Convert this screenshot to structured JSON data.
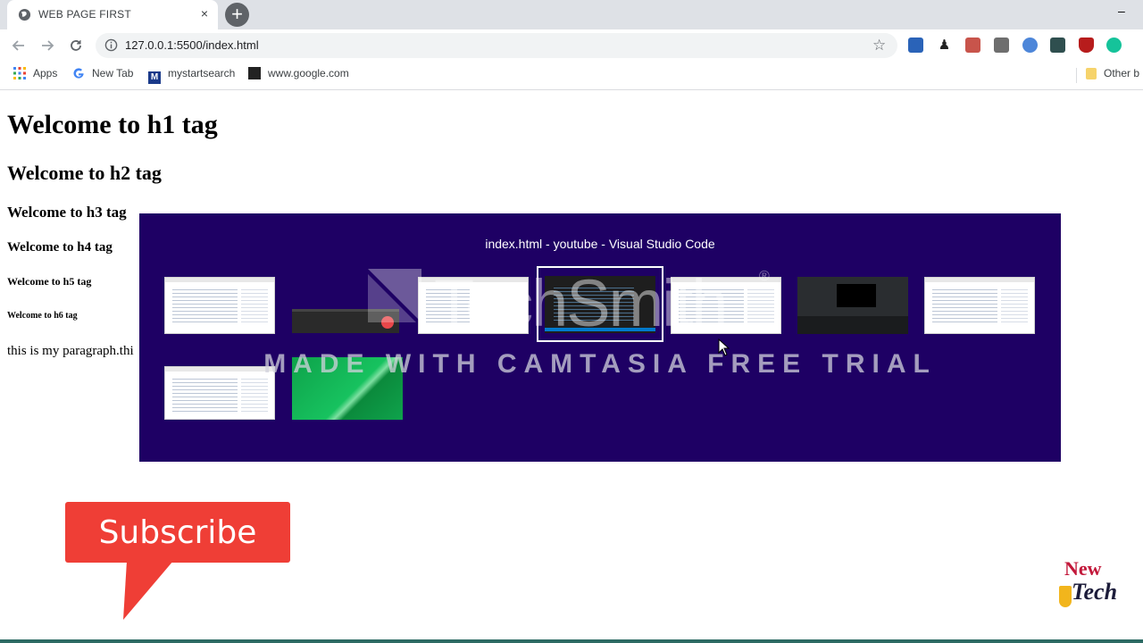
{
  "browser": {
    "tab_title": "WEB PAGE FIRST",
    "tab_close": "×",
    "new_tab": "+",
    "url": "127.0.0.1:5500/index.html",
    "window_minimize": "–"
  },
  "bookmarks": [
    {
      "label": "Apps",
      "icon": "apps-grid-icon"
    },
    {
      "label": "New Tab",
      "icon": "google-g-icon"
    },
    {
      "label": "mystartsearch",
      "icon": "mystartsearch-icon"
    },
    {
      "label": "www.google.com",
      "icon": "bookmark-page-icon"
    },
    {
      "label": "Other b",
      "icon": "folder-icon"
    }
  ],
  "page": {
    "h1": "Welcome to h1 tag",
    "h2": "Welcome to h2 tag",
    "h3": "Welcome to h3 tag",
    "h4": "Welcome to h4 tag",
    "h5": "Welcome to h5 tag",
    "h6": "Welcome to h6 tag",
    "paragraph": "this is my paragraph.thi"
  },
  "switcher": {
    "title": "index.html - youtube - Visual Studio Code",
    "selected_index": 3
  },
  "watermark": {
    "logo": "TechSmith",
    "registered": "®",
    "text": "MADE WITH CAMTASIA FREE TRIAL"
  },
  "overlay": {
    "subscribe": "Subscribe",
    "logo_top": "New",
    "logo_bottom": "Tech"
  },
  "colors": {
    "switcher_bg": "#1e0064",
    "subscribe_bg": "#ef3e36"
  }
}
